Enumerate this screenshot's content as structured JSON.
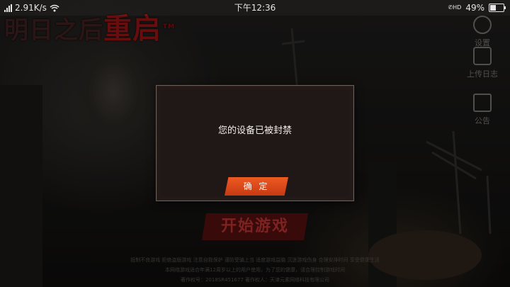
{
  "status_bar": {
    "network_speed": "2.91K/s",
    "time": "下午12:36",
    "network_type": "HD",
    "battery": "49%",
    "battery_level": 0.49,
    "icons": [
      "signal-icon",
      "wifi-icon",
      "phone-hd-icon",
      "battery-icon"
    ]
  },
  "background": {
    "logo_prefix": "明日之后",
    "logo_text": "重启",
    "logo_tag": "TM"
  },
  "side_menu": {
    "items": [
      {
        "label": "设置",
        "icon": "gear-icon"
      },
      {
        "label": "上传日志",
        "icon": "upload-icon"
      },
      {
        "label": "公告",
        "icon": "notice-icon"
      }
    ]
  },
  "start_button": {
    "label": "开始游戏"
  },
  "footer": {
    "line1": "抵制不良游戏 拒绝盗版游戏 注意自我保护 谨防受骗上当 适度游戏益脑 沉迷游戏伤身 合理安排时间 享受健康生活",
    "line2": "本网络游戏适合年满12周岁以上的用户使用，为了您的健康，请合理控制游戏时间",
    "line3": "著作权号：2018SR451677     著作权人：天津元素网络科技有限公司"
  },
  "dialog": {
    "message": "您的设备已被封禁",
    "confirm_label": "确 定"
  },
  "colors": {
    "accent_button": "#e0501c",
    "dialog_bg": "#231a18",
    "logo_red": "#8a1212"
  }
}
